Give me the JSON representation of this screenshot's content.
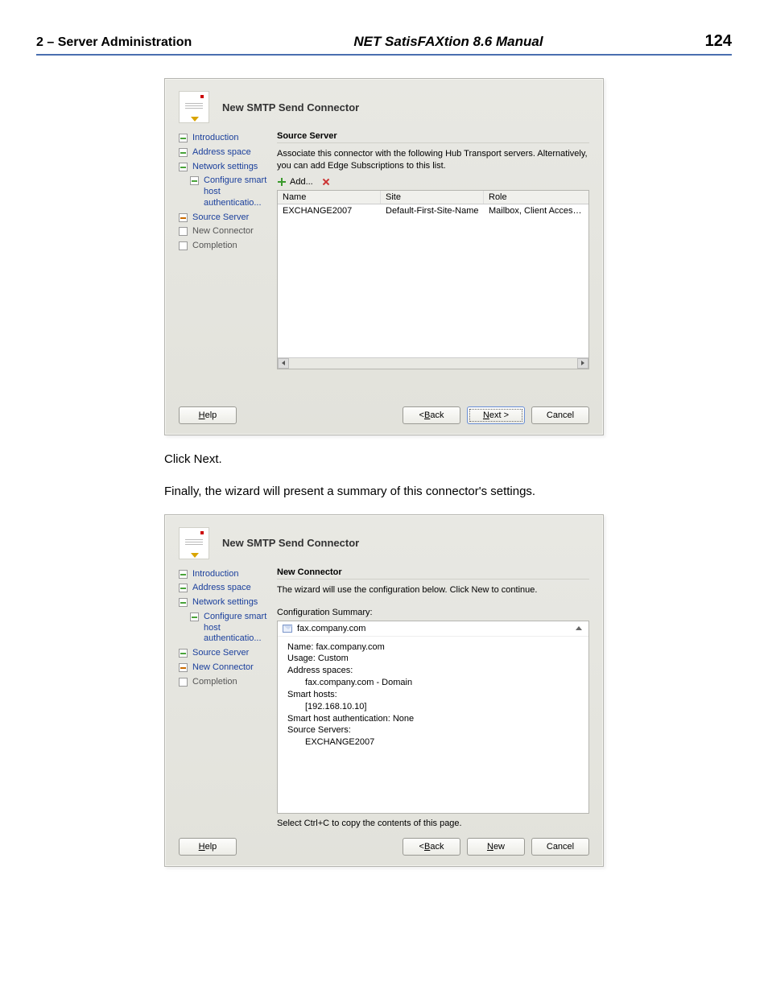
{
  "header": {
    "chapter": "2  –  Server Administration",
    "manual": "NET SatisFAXtion 8.6 Manual",
    "page": "124"
  },
  "dialog1": {
    "title": "New SMTP Send Connector",
    "nav": [
      {
        "label": "Introduction",
        "state": "done"
      },
      {
        "label": "Address space",
        "state": "done"
      },
      {
        "label": "Network settings",
        "state": "done"
      },
      {
        "label": "Configure smart host authenticatio...",
        "state": "done",
        "sub": true
      },
      {
        "label": "Source Server",
        "state": "current"
      },
      {
        "label": "New Connector",
        "state": "pending"
      },
      {
        "label": "Completion",
        "state": "pending"
      }
    ],
    "heading": "Source Server",
    "description": "Associate this connector with the following Hub Transport servers. Alternatively, you can add Edge Subscriptions to this list.",
    "toolbar": {
      "add": "Add..."
    },
    "grid": {
      "cols": [
        "Name",
        "Site",
        "Role"
      ],
      "rows": [
        {
          "name": "EXCHANGE2007",
          "site": "Default-First-Site-Name",
          "role": "Mailbox, Client Access, Un"
        }
      ]
    },
    "buttons": {
      "help": "Help",
      "back": "< Back",
      "next": "Next >",
      "cancel": "Cancel"
    }
  },
  "body_text": {
    "line1": "Click Next.",
    "line2": "Finally, the wizard will present a summary of this connector's settings."
  },
  "dialog2": {
    "title": "New SMTP Send Connector",
    "nav": [
      {
        "label": "Introduction",
        "state": "done"
      },
      {
        "label": "Address space",
        "state": "done"
      },
      {
        "label": "Network settings",
        "state": "done"
      },
      {
        "label": "Configure smart host authenticatio...",
        "state": "done",
        "sub": true
      },
      {
        "label": "Source Server",
        "state": "done"
      },
      {
        "label": "New Connector",
        "state": "current"
      },
      {
        "label": "Completion",
        "state": "pending"
      }
    ],
    "heading": "New Connector",
    "description": "The wizard will use the configuration below.  Click New to continue.",
    "summary_label": "Configuration Summary:",
    "summary_title": "fax.company.com",
    "summary_lines": [
      "Name: fax.company.com",
      "Usage: Custom",
      "Address spaces:",
      "    fax.company.com - Domain",
      "Smart hosts:",
      "    [192.168.10.10]",
      "Smart host authentication: None",
      "Source Servers:",
      "    EXCHANGE2007"
    ],
    "copy_hint": "Select Ctrl+C to copy the contents of this page.",
    "buttons": {
      "help": "Help",
      "back": "< Back",
      "new": "New",
      "cancel": "Cancel"
    }
  }
}
